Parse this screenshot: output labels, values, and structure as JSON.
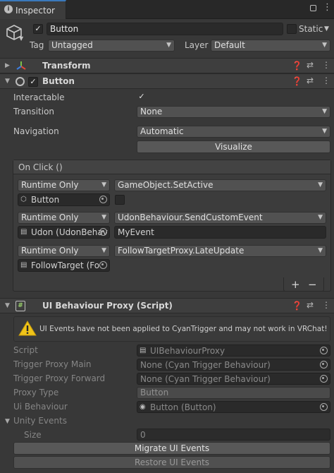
{
  "tab": {
    "title": "Inspector"
  },
  "object": {
    "name": "Button",
    "static_label": "Static",
    "tag_label": "Tag",
    "tag_value": "Untagged",
    "layer_label": "Layer",
    "layer_value": "Default"
  },
  "transform": {
    "title": "Transform"
  },
  "button_component": {
    "title": "Button",
    "interactable_label": "Interactable",
    "transition_label": "Transition",
    "transition_value": "None",
    "navigation_label": "Navigation",
    "navigation_value": "Automatic",
    "visualize_label": "Visualize",
    "onclick_title": "On Click ()",
    "events": [
      {
        "mode": "Runtime Only",
        "function": "GameObject.SetActive",
        "target": "Button",
        "arg": ""
      },
      {
        "mode": "Runtime Only",
        "function": "UdonBehaviour.SendCustomEvent",
        "target": "Udon (UdonBehav",
        "arg": "MyEvent"
      },
      {
        "mode": "Runtime Only",
        "function": "FollowTargetProxy.LateUpdate",
        "target": "FollowTarget (Fo",
        "arg": ""
      }
    ],
    "add_label": "+",
    "remove_label": "−"
  },
  "ui_proxy": {
    "title": "UI Behaviour Proxy (Script)",
    "warning": "UI Events have not been applied to CyanTrigger and may not work in VRChat!",
    "script_label": "Script",
    "script_value": "UIBehaviourProxy",
    "trigger_main_label": "Trigger Proxy Main",
    "trigger_main_value": "None (Cyan Trigger Behaviour)",
    "trigger_forward_label": "Trigger Proxy Forward",
    "trigger_forward_value": "None (Cyan Trigger Behaviour)",
    "proxy_type_label": "Proxy Type",
    "proxy_type_value": "Button",
    "ui_behaviour_label": "Ui Behaviour",
    "ui_behaviour_value": "Button (Button)",
    "unity_events_label": "Unity Events",
    "size_label": "Size",
    "size_value": "0",
    "migrate_label": "Migrate UI Events",
    "restore_label": "Restore UI Events"
  },
  "colors": {
    "accent": "#3a79bb",
    "background": "#383838",
    "warning": "#f0c419"
  }
}
